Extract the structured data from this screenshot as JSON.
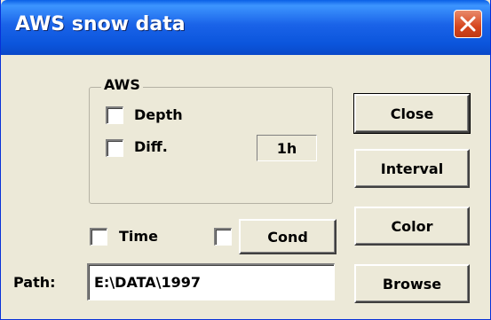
{
  "window": {
    "title": "AWS snow data"
  },
  "aws_group": {
    "title": "AWS",
    "depth_label": "Depth",
    "diff_label": "Diff.",
    "interval_value": "1h"
  },
  "time_label": "Time",
  "cond_label": "Cond",
  "path": {
    "label": "Path:",
    "value": "E:\\DATA\\1997"
  },
  "buttons": {
    "close": "Close",
    "interval": "Interval",
    "color": "Color",
    "browse": "Browse"
  },
  "colors": {
    "titlebar": "#0b55dc",
    "face": "#ece9d8",
    "close_x": "#d6461f"
  }
}
